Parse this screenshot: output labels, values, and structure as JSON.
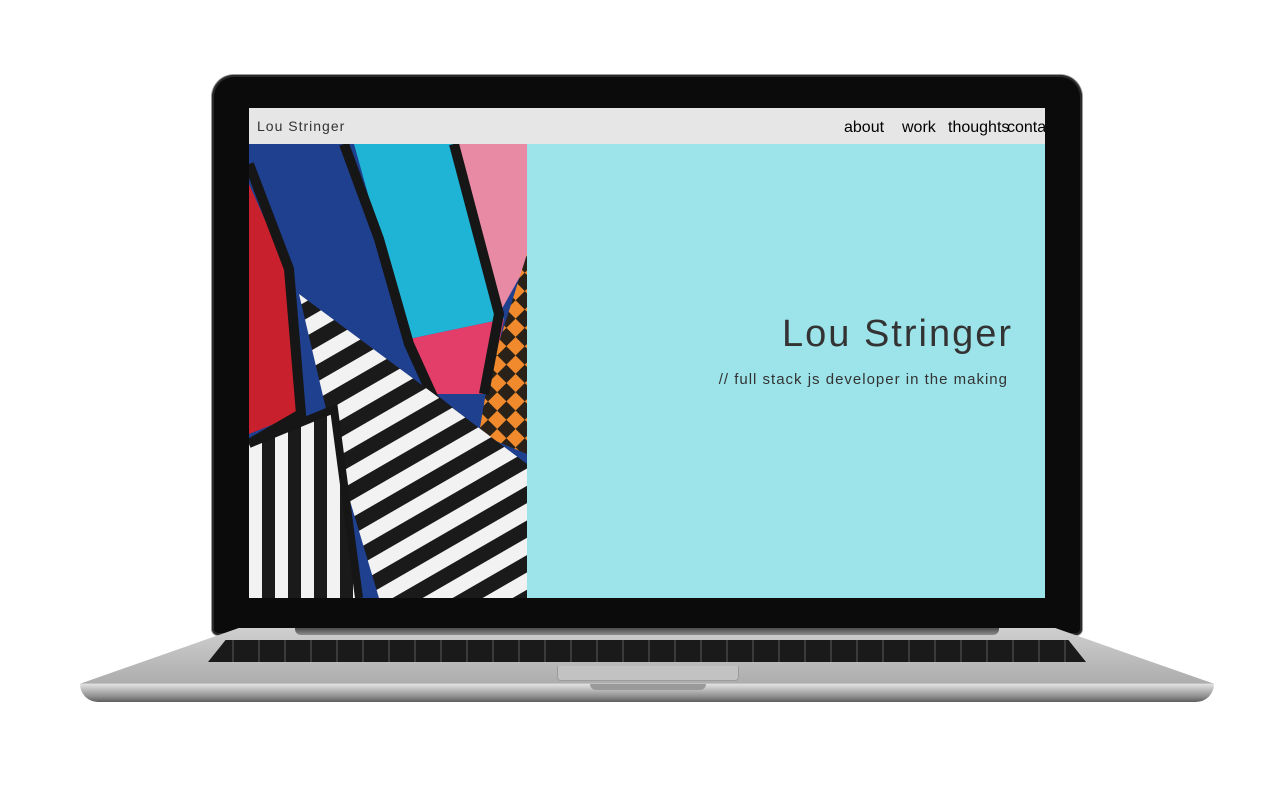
{
  "site": {
    "brand": "Lou Stringer",
    "nav": {
      "about": "about",
      "work": "work",
      "thoughts": "thoughts",
      "contact": "contact"
    },
    "hero": {
      "title": "Lou Stringer",
      "subtitle": "// full stack js developer in the making"
    },
    "colors": {
      "navbar_bg": "#e6e6e6",
      "hero_bg": "#9de4ea",
      "text": "#333333"
    }
  },
  "device": {
    "type": "laptop-mockup"
  }
}
